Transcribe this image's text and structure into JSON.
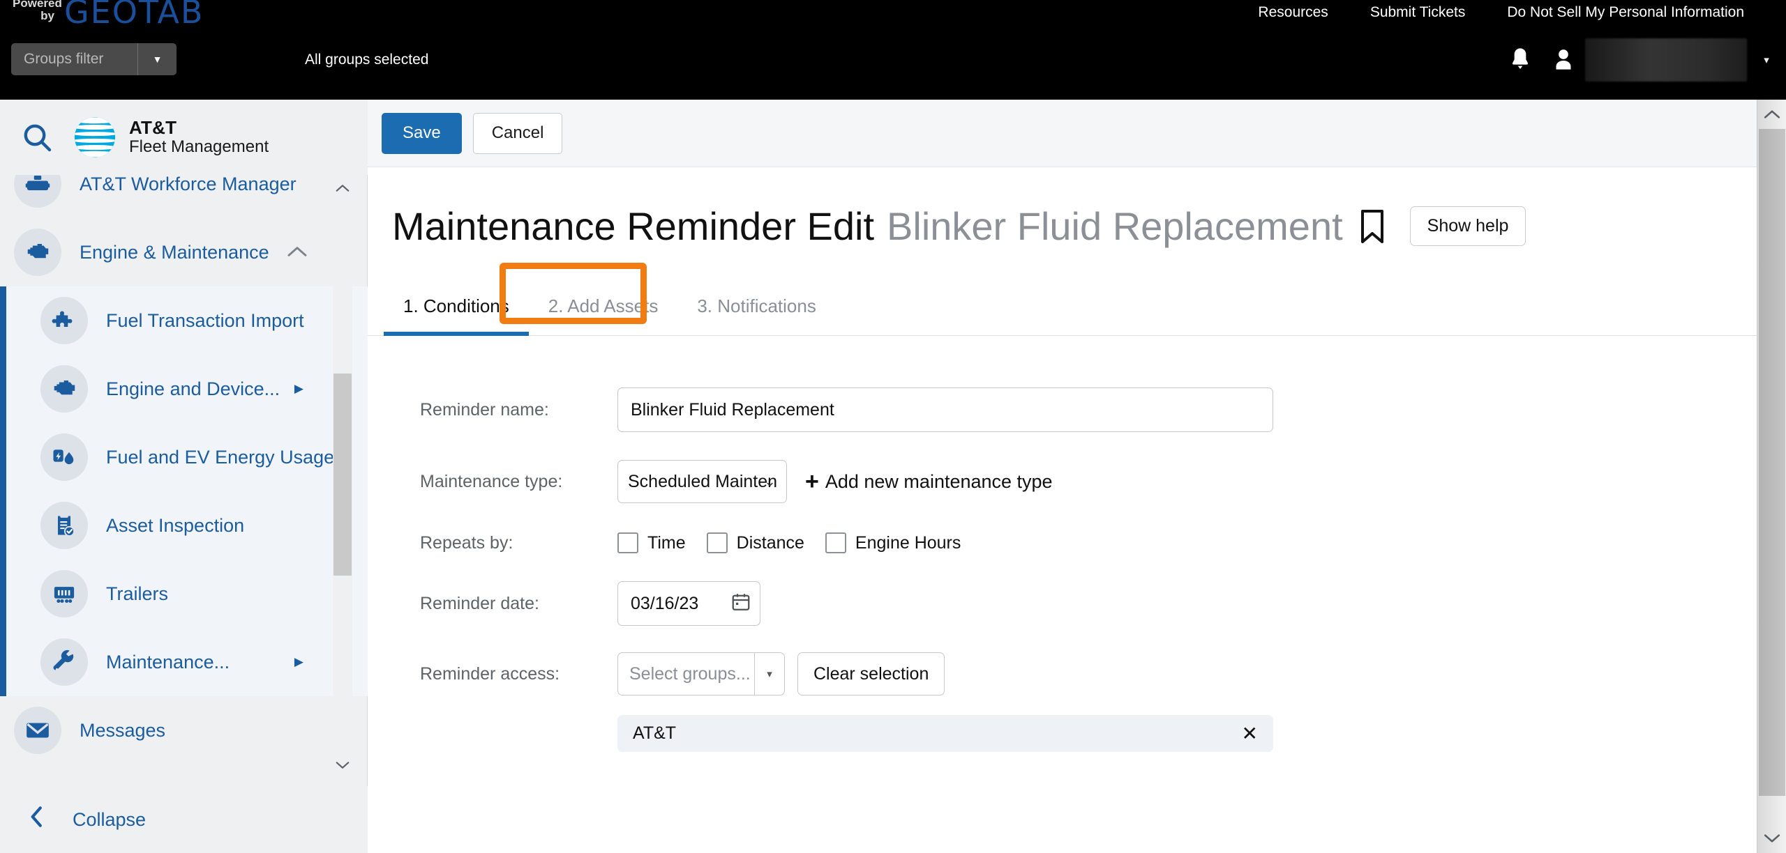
{
  "topbar": {
    "powered_line1": "Powered",
    "powered_line2": "by",
    "brand_logo": "GEOTAB",
    "nav": [
      {
        "label": "Resources"
      },
      {
        "label": "Submit Tickets"
      },
      {
        "label": "Do Not Sell My Personal Information"
      }
    ],
    "groups_filter_placeholder": "Groups filter",
    "groups_status": "All groups selected",
    "bell_icon": "bell-icon",
    "person_icon": "person-icon",
    "user_name_redacted": "",
    "user_caret": "▾"
  },
  "sidebar": {
    "search_icon": "search-icon",
    "brand_line1": "AT&T",
    "brand_line2": "Fleet Management",
    "items": [
      {
        "label": "AT&T Workforce Manager",
        "icon": "workforce-icon",
        "level": "top",
        "partial": true
      },
      {
        "label": "Engine & Maintenance",
        "icon": "engine-icon",
        "level": "top",
        "expanded": true,
        "chevron": "⌃"
      }
    ],
    "sub_items": [
      {
        "label": "Fuel Transaction Import",
        "icon": "puzzle-icon",
        "has_arrow": false
      },
      {
        "label": "Engine and Device...",
        "icon": "engine-icon",
        "has_arrow": true
      },
      {
        "label": "Fuel and EV Energy Usage",
        "icon": "fuel-ev-icon",
        "has_arrow": false
      },
      {
        "label": "Asset Inspection",
        "icon": "clipboard-check-icon",
        "has_arrow": false
      },
      {
        "label": "Trailers",
        "icon": "trailer-icon",
        "has_arrow": false
      },
      {
        "label": "Maintenance...",
        "icon": "wrench-icon",
        "has_arrow": true
      }
    ],
    "messages": {
      "label": "Messages",
      "icon": "envelope-icon"
    },
    "collapse": {
      "label": "Collapse",
      "icon": "chevron-left-icon"
    }
  },
  "actionbar": {
    "save_label": "Save",
    "cancel_label": "Cancel"
  },
  "page": {
    "title": "Maintenance Reminder Edit",
    "subtitle": "Blinker Fluid Replacement",
    "bookmark_icon": "bookmark-icon",
    "show_help_label": "Show help"
  },
  "tabs": [
    {
      "label": "1. Conditions",
      "active": true
    },
    {
      "label": "2. Add Assets",
      "active": false,
      "highlighted": true
    },
    {
      "label": "3. Notifications",
      "active": false
    }
  ],
  "form": {
    "reminder_name": {
      "label": "Reminder name:",
      "value": "Blinker Fluid Replacement"
    },
    "maintenance_type": {
      "label": "Maintenance type:",
      "value": "Scheduled Maintenance",
      "options": [
        "Scheduled Maintenance"
      ],
      "add_new_label": "Add new maintenance type",
      "add_new_plus": "+"
    },
    "repeats_by": {
      "label": "Repeats by:",
      "options": [
        {
          "label": "Time",
          "checked": false
        },
        {
          "label": "Distance",
          "checked": false
        },
        {
          "label": "Engine Hours",
          "checked": false
        }
      ]
    },
    "reminder_date": {
      "label": "Reminder date:",
      "value": "03/16/23",
      "calendar_icon": "calendar-icon"
    },
    "reminder_access": {
      "label": "Reminder access:",
      "placeholder": "Select groups...",
      "dropdown_caret": "▾",
      "clear_label": "Clear selection",
      "selected_chip": {
        "label": "AT&T",
        "remove_icon": "✕"
      }
    }
  },
  "scrollbars": {
    "up_caret": "⌃",
    "down_caret": "⌄"
  },
  "colors": {
    "accent_blue": "#1b6cb0",
    "sidebar_blue": "#1b5c9e",
    "annotation_orange": "#f07c12",
    "topbar_black": "#000000",
    "geotab_blue": "#1a4f9c"
  }
}
